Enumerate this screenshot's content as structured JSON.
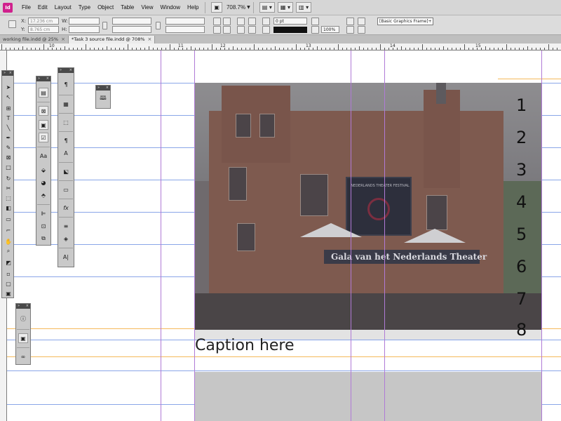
{
  "app": {
    "icon_label": "Id",
    "menu": [
      "File",
      "Edit",
      "Layout",
      "Type",
      "Object",
      "Table",
      "View",
      "Window",
      "Help"
    ],
    "zoom": "708.7%"
  },
  "control_bar": {
    "x_label": "X:",
    "y_label": "Y:",
    "w_label": "W:",
    "h_label": "H:",
    "x_value": "17.236 cm",
    "y_value": "8.765 cm",
    "stroke_weight": "0 pt",
    "opacity": "100%",
    "object_style": "[Basic Graphics Frame]+"
  },
  "tabs": [
    {
      "label": "working file.indd @ 25%",
      "active": false
    },
    {
      "label": "*Task 3 source file.indd @ 708%",
      "active": true
    }
  ],
  "ruler": {
    "labels": [
      "10",
      "11",
      "12",
      "13",
      "14",
      "15"
    ]
  },
  "document": {
    "numbers": [
      "1",
      "2",
      "3",
      "4",
      "5",
      "6",
      "7",
      "8"
    ],
    "caption": "Caption here",
    "photo_sign": "Gala van het Nederlands Theater",
    "banner_text": "NEDERLANDS THEATER FESTIVAL"
  },
  "colors": {
    "guide_blue": "#8aa6e8",
    "guide_orange": "#f5b95a",
    "column_guide": "#b07ad6",
    "app_accent": "#d0218d"
  }
}
